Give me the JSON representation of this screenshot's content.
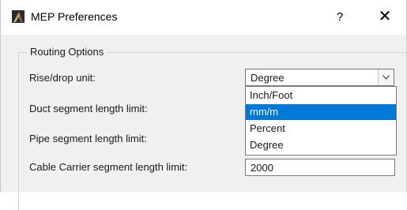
{
  "window": {
    "title": "MEP Preferences",
    "help_label": "?",
    "close_label": "✕",
    "app_icon": "archicad-icon"
  },
  "routing": {
    "group_title": "Routing Options",
    "rise_drop_label": "Rise/drop unit:",
    "rise_drop_value": "Degree",
    "options": [
      "Inch/Foot",
      "mm/m",
      "Percent",
      "Degree"
    ],
    "highlighted_option": "mm/m",
    "duct_label": "Duct segment length limit:",
    "pipe_label": "Pipe segment length limit:",
    "cable_label": "Cable Carrier segment length limit:",
    "cable_value": "2000"
  },
  "colors": {
    "highlight": "#0078d7",
    "background": "#f0f0f0"
  }
}
